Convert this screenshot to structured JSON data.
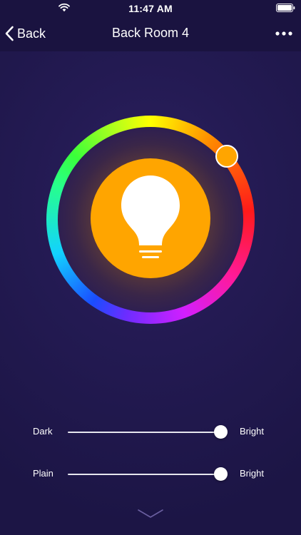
{
  "status_bar": {
    "time": "11:47 AM",
    "wifi_icon": "wifi-icon",
    "battery_icon": "battery-full-icon"
  },
  "nav": {
    "back_label": "Back",
    "title": "Back Room 4",
    "back_icon": "chevron-left-icon",
    "more_icon": "ellipsis-icon"
  },
  "light": {
    "icon": "lightbulb-icon",
    "selected_color": "#ffa500",
    "wheel_colors": [
      "#ffff00",
      "#ff8800",
      "#ff1a1a",
      "#ff1a9a",
      "#d21fff",
      "#6a2dff",
      "#1a4dff",
      "#12d2ff",
      "#27ff8c",
      "#3aff3a",
      "#b6ff1a"
    ]
  },
  "sliders": [
    {
      "left_label": "Dark",
      "right_label": "Bright",
      "value": 0.97
    },
    {
      "left_label": "Plain",
      "right_label": "Bright",
      "value": 0.97
    }
  ],
  "footer": {
    "expand_icon": "chevron-down-icon"
  },
  "colors": {
    "background": "#231a52",
    "nav_background": "#1a1340",
    "accent": "#ffa500"
  }
}
